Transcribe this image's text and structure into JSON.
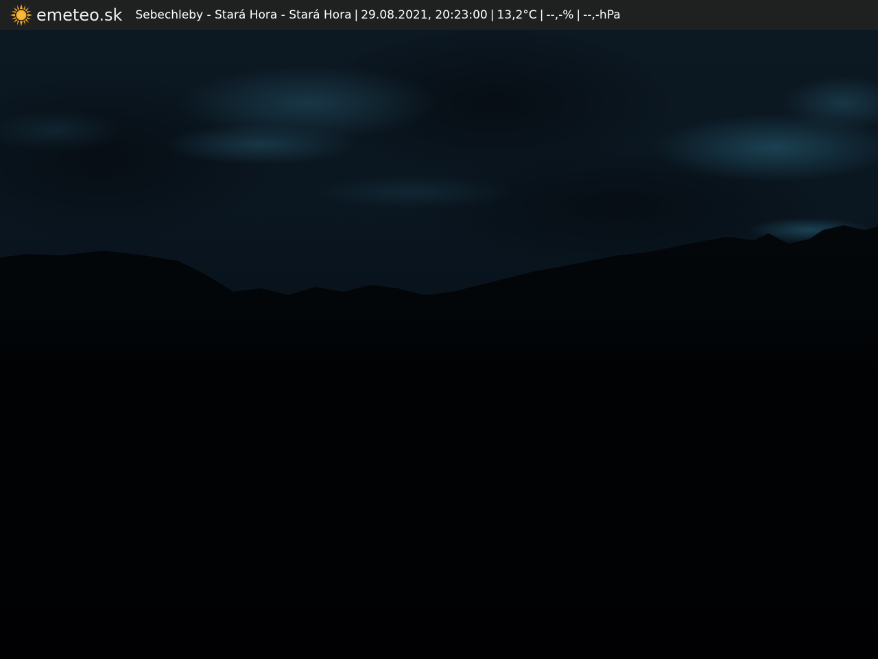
{
  "overlay": {
    "brand": "emeteo.sk",
    "logo_icon": "sun-icon",
    "station": "Sebechleby - Stará Hora - Stará Hora",
    "datetime": "29.08.2021, 20:23:00",
    "temperature": "13,2°C",
    "humidity": "--,-%",
    "pressure": "--,-hPa",
    "separator": "|"
  },
  "image": {
    "description_colors": {
      "sky": "#0b1620",
      "cloud_highlight": "#1b3c4c",
      "ground": "#020304"
    }
  }
}
